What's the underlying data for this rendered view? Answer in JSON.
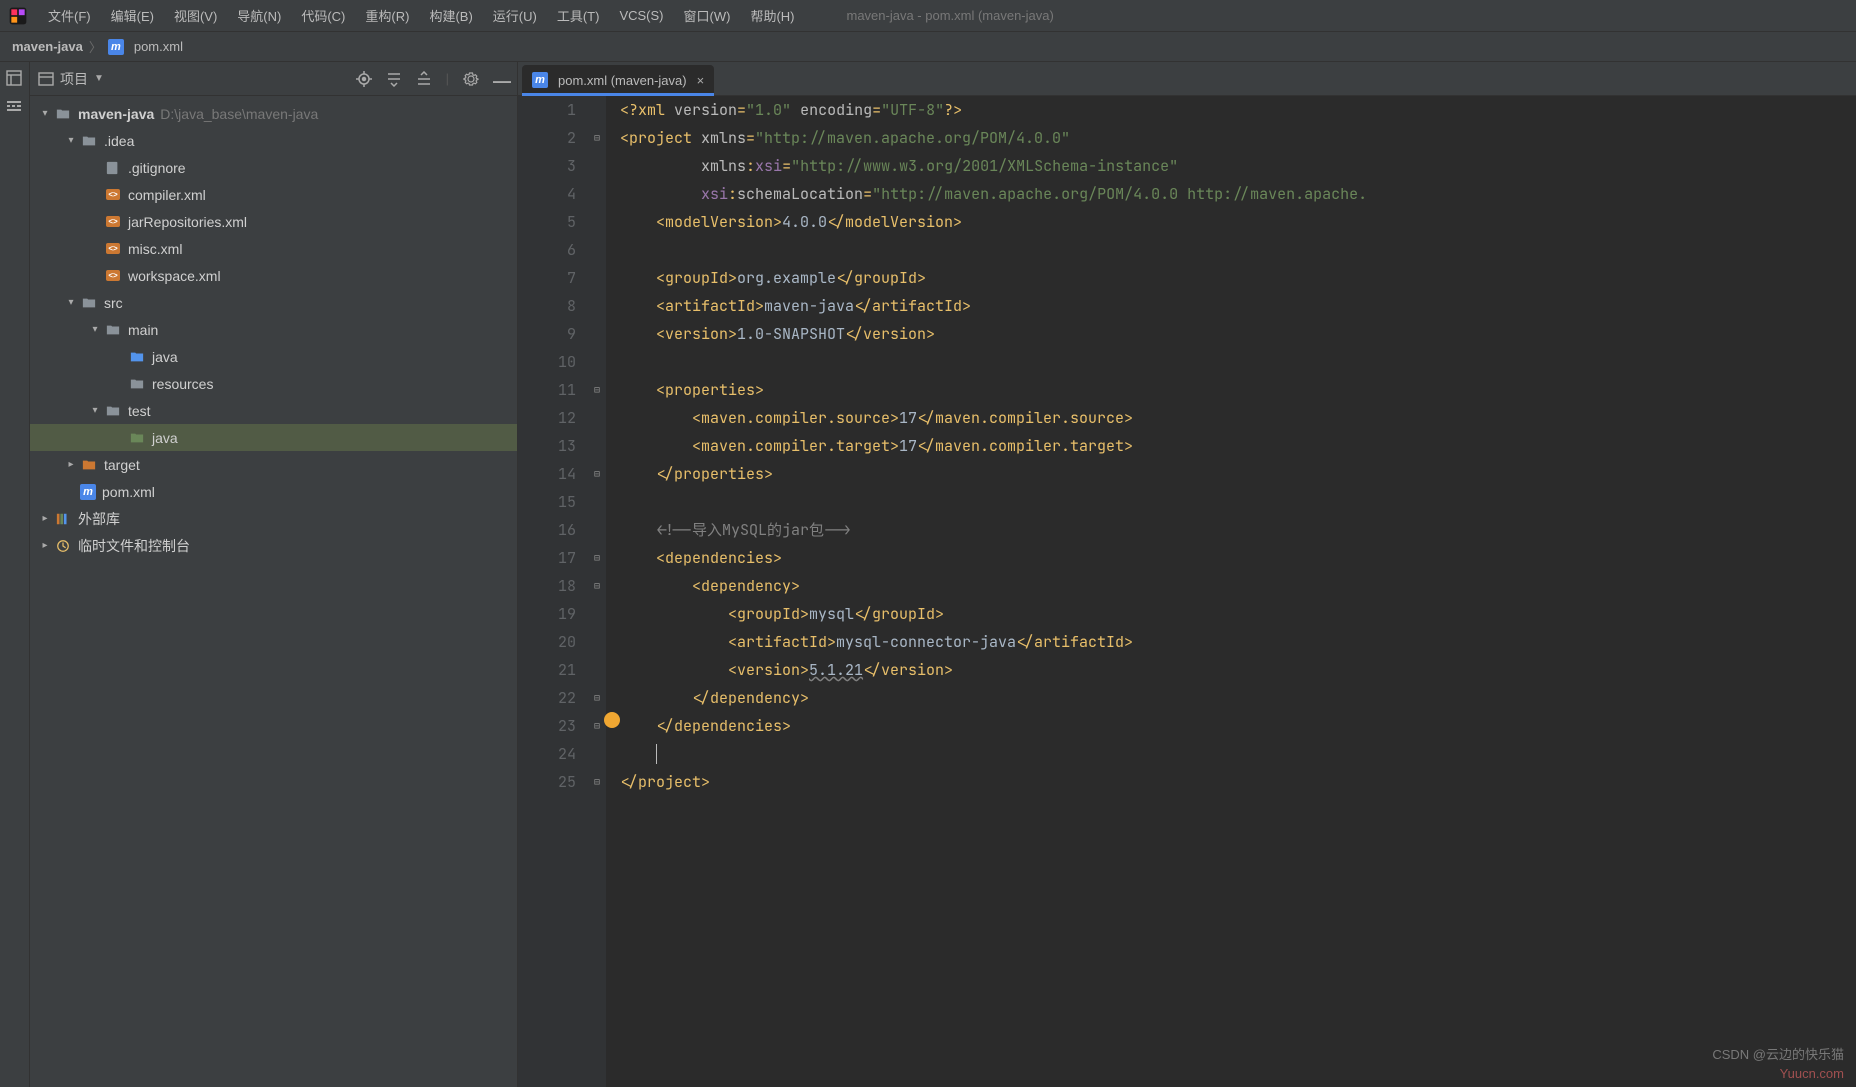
{
  "window": {
    "title": "maven-java - pom.xml (maven-java)"
  },
  "menu": {
    "file": "文件(F)",
    "edit": "编辑(E)",
    "view": "视图(V)",
    "navigate": "导航(N)",
    "code": "代码(C)",
    "refactor": "重构(R)",
    "build": "构建(B)",
    "run": "运行(U)",
    "tools": "工具(T)",
    "vcs": "VCS(S)",
    "window": "窗口(W)",
    "help": "帮助(H)"
  },
  "breadcrumb": {
    "project": "maven-java",
    "file": "pom.xml"
  },
  "sidebar": {
    "title": "项目",
    "project_name": "maven-java",
    "project_path": "D:\\java_base\\maven-java",
    "idea": ".idea",
    "idea_children": {
      "gitignore": ".gitignore",
      "compiler": "compiler.xml",
      "jarRepositories": "jarRepositories.xml",
      "misc": "misc.xml",
      "workspace": "workspace.xml"
    },
    "src": "src",
    "main": "main",
    "main_children": {
      "java": "java",
      "resources": "resources"
    },
    "test": "test",
    "test_children": {
      "java": "java"
    },
    "target": "target",
    "pom": "pom.xml",
    "external_libs": "外部库",
    "scratches": "临时文件和控制台"
  },
  "tab": {
    "label": "pom.xml (maven-java)"
  },
  "code": {
    "lines": [
      "1",
      "2",
      "3",
      "4",
      "5",
      "6",
      "7",
      "8",
      "9",
      "10",
      "11",
      "12",
      "13",
      "14",
      "15",
      "16",
      "17",
      "18",
      "19",
      "20",
      "21",
      "22",
      "23",
      "24",
      "25"
    ],
    "xml_decl_version": "1.0",
    "xml_decl_encoding": "UTF-8",
    "project_ns": "http://maven.apache.org/POM/4.0.0",
    "xsi_ns": "http://www.w3.org/2001/XMLSchema-instance",
    "schema_loc": "http://maven.apache.org/POM/4.0.0 http://maven.apache.",
    "modelVersion": "4.0.0",
    "groupId": "org.example",
    "artifactId": "maven-java",
    "version": "1.0-SNAPSHOT",
    "compiler_source": "17",
    "compiler_target": "17",
    "comment": "<!--导入MySQL的jar包-->",
    "dep_groupId": "mysql",
    "dep_artifactId": "mysql-connector-java",
    "dep_version": "5.1.21"
  },
  "watermark": {
    "csdn": "CSDN @云边的快乐猫",
    "domain": "Yuucn.com"
  }
}
